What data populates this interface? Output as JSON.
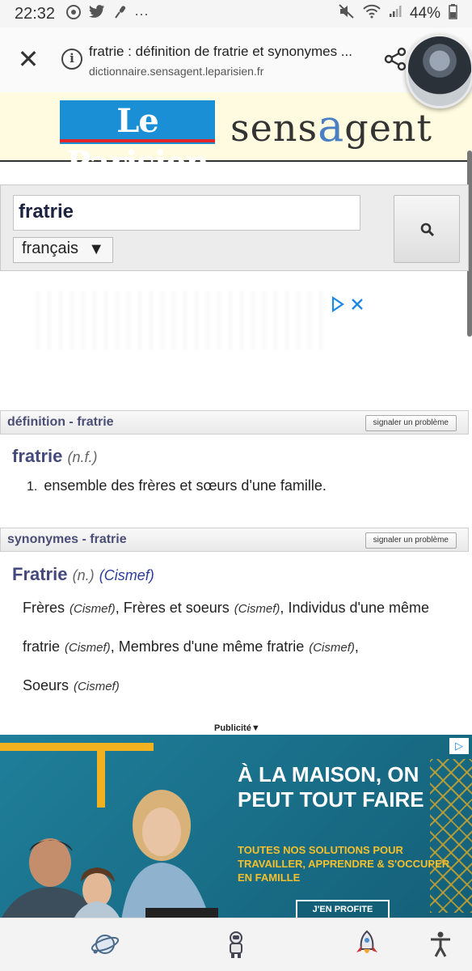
{
  "status_bar": {
    "time": "22:32",
    "dots": "···",
    "battery": "44%",
    "icons": [
      "chrome-icon",
      "twitter-icon",
      "microphone-icon",
      "mute-icon",
      "wifi-icon",
      "signal-icon",
      "battery-icon"
    ]
  },
  "tab": {
    "title": "fratrie : définition de fratrie et synonymes ...",
    "url": "dictionnaire.sensagent.leparisien.fr"
  },
  "header": {
    "leparisien_logo": "Le Parisien",
    "sensagent_pre": "sens",
    "sensagent_a": "a",
    "sensagent_post": "gent"
  },
  "search": {
    "value": "fratrie",
    "language": "français"
  },
  "definition_section": {
    "title": "définition - fratrie",
    "report": "signaler un problème",
    "word": "fratrie",
    "gram": "(n.f.)",
    "items": [
      {
        "num": "1.",
        "text": "ensemble des frères et sœurs d'une famille."
      }
    ]
  },
  "synonyms_section": {
    "title": "synonymes - fratrie",
    "report": "signaler un problème",
    "word": "Fratrie",
    "gram": "(n.)",
    "source_open": "(",
    "source": "Cismef",
    "source_close": ")",
    "list": [
      {
        "term": "Frères",
        "src": "(Cismef)",
        "sep": ", "
      },
      {
        "term": "Frères et soeurs",
        "src": "(Cismef)",
        "sep": ", "
      },
      {
        "term": "Individus d'une même fratrie",
        "src": "(Cismef)",
        "sep": ", "
      },
      {
        "term": "Membres d'une même fratrie",
        "src": "(Cismef)",
        "sep": ", "
      },
      {
        "term": "Soeurs",
        "src": "(Cismef)",
        "sep": ""
      }
    ]
  },
  "publicite": {
    "label": "Publicité",
    "arrow": "▼"
  },
  "ad_banner": {
    "headline": "À LA MAISON, ON PEUT TOUT FAIRE",
    "sub": "TOUTES NOS SOLUTIONS POUR TRAVAILLER, APPRENDRE & S'OCCUPER EN FAMILLE",
    "cta": "J'EN PROFITE"
  },
  "colors": {
    "section_title": "#4b4f76",
    "leparisien_blue": "#1a8fd6",
    "ad_teal": "#1f7f9a",
    "ad_yellow": "#f5c02b"
  },
  "bottom_nav": [
    "planet-icon",
    "astronaut-icon",
    "rocket-icon",
    "accessibility-icon"
  ]
}
